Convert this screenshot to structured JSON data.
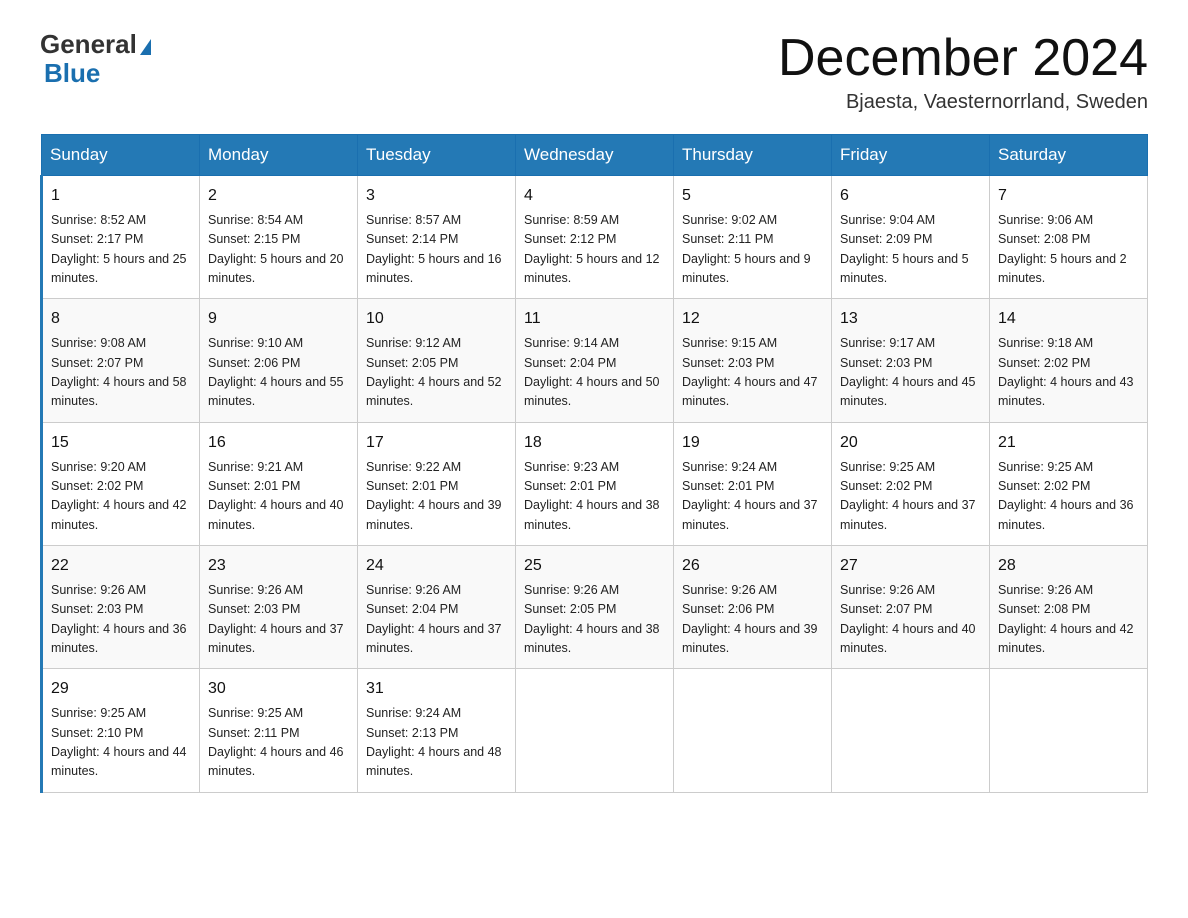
{
  "header": {
    "logo_general": "General",
    "logo_blue": "Blue",
    "month_title": "December 2024",
    "location": "Bjaesta, Vaesternorrland, Sweden"
  },
  "days_of_week": [
    "Sunday",
    "Monday",
    "Tuesday",
    "Wednesday",
    "Thursday",
    "Friday",
    "Saturday"
  ],
  "weeks": [
    [
      {
        "day": "1",
        "sunrise": "8:52 AM",
        "sunset": "2:17 PM",
        "daylight": "5 hours and 25 minutes."
      },
      {
        "day": "2",
        "sunrise": "8:54 AM",
        "sunset": "2:15 PM",
        "daylight": "5 hours and 20 minutes."
      },
      {
        "day": "3",
        "sunrise": "8:57 AM",
        "sunset": "2:14 PM",
        "daylight": "5 hours and 16 minutes."
      },
      {
        "day": "4",
        "sunrise": "8:59 AM",
        "sunset": "2:12 PM",
        "daylight": "5 hours and 12 minutes."
      },
      {
        "day": "5",
        "sunrise": "9:02 AM",
        "sunset": "2:11 PM",
        "daylight": "5 hours and 9 minutes."
      },
      {
        "day": "6",
        "sunrise": "9:04 AM",
        "sunset": "2:09 PM",
        "daylight": "5 hours and 5 minutes."
      },
      {
        "day": "7",
        "sunrise": "9:06 AM",
        "sunset": "2:08 PM",
        "daylight": "5 hours and 2 minutes."
      }
    ],
    [
      {
        "day": "8",
        "sunrise": "9:08 AM",
        "sunset": "2:07 PM",
        "daylight": "4 hours and 58 minutes."
      },
      {
        "day": "9",
        "sunrise": "9:10 AM",
        "sunset": "2:06 PM",
        "daylight": "4 hours and 55 minutes."
      },
      {
        "day": "10",
        "sunrise": "9:12 AM",
        "sunset": "2:05 PM",
        "daylight": "4 hours and 52 minutes."
      },
      {
        "day": "11",
        "sunrise": "9:14 AM",
        "sunset": "2:04 PM",
        "daylight": "4 hours and 50 minutes."
      },
      {
        "day": "12",
        "sunrise": "9:15 AM",
        "sunset": "2:03 PM",
        "daylight": "4 hours and 47 minutes."
      },
      {
        "day": "13",
        "sunrise": "9:17 AM",
        "sunset": "2:03 PM",
        "daylight": "4 hours and 45 minutes."
      },
      {
        "day": "14",
        "sunrise": "9:18 AM",
        "sunset": "2:02 PM",
        "daylight": "4 hours and 43 minutes."
      }
    ],
    [
      {
        "day": "15",
        "sunrise": "9:20 AM",
        "sunset": "2:02 PM",
        "daylight": "4 hours and 42 minutes."
      },
      {
        "day": "16",
        "sunrise": "9:21 AM",
        "sunset": "2:01 PM",
        "daylight": "4 hours and 40 minutes."
      },
      {
        "day": "17",
        "sunrise": "9:22 AM",
        "sunset": "2:01 PM",
        "daylight": "4 hours and 39 minutes."
      },
      {
        "day": "18",
        "sunrise": "9:23 AM",
        "sunset": "2:01 PM",
        "daylight": "4 hours and 38 minutes."
      },
      {
        "day": "19",
        "sunrise": "9:24 AM",
        "sunset": "2:01 PM",
        "daylight": "4 hours and 37 minutes."
      },
      {
        "day": "20",
        "sunrise": "9:25 AM",
        "sunset": "2:02 PM",
        "daylight": "4 hours and 37 minutes."
      },
      {
        "day": "21",
        "sunrise": "9:25 AM",
        "sunset": "2:02 PM",
        "daylight": "4 hours and 36 minutes."
      }
    ],
    [
      {
        "day": "22",
        "sunrise": "9:26 AM",
        "sunset": "2:03 PM",
        "daylight": "4 hours and 36 minutes."
      },
      {
        "day": "23",
        "sunrise": "9:26 AM",
        "sunset": "2:03 PM",
        "daylight": "4 hours and 37 minutes."
      },
      {
        "day": "24",
        "sunrise": "9:26 AM",
        "sunset": "2:04 PM",
        "daylight": "4 hours and 37 minutes."
      },
      {
        "day": "25",
        "sunrise": "9:26 AM",
        "sunset": "2:05 PM",
        "daylight": "4 hours and 38 minutes."
      },
      {
        "day": "26",
        "sunrise": "9:26 AM",
        "sunset": "2:06 PM",
        "daylight": "4 hours and 39 minutes."
      },
      {
        "day": "27",
        "sunrise": "9:26 AM",
        "sunset": "2:07 PM",
        "daylight": "4 hours and 40 minutes."
      },
      {
        "day": "28",
        "sunrise": "9:26 AM",
        "sunset": "2:08 PM",
        "daylight": "4 hours and 42 minutes."
      }
    ],
    [
      {
        "day": "29",
        "sunrise": "9:25 AM",
        "sunset": "2:10 PM",
        "daylight": "4 hours and 44 minutes."
      },
      {
        "day": "30",
        "sunrise": "9:25 AM",
        "sunset": "2:11 PM",
        "daylight": "4 hours and 46 minutes."
      },
      {
        "day": "31",
        "sunrise": "9:24 AM",
        "sunset": "2:13 PM",
        "daylight": "4 hours and 48 minutes."
      },
      null,
      null,
      null,
      null
    ]
  ],
  "labels": {
    "sunrise": "Sunrise:",
    "sunset": "Sunset:",
    "daylight": "Daylight:"
  }
}
